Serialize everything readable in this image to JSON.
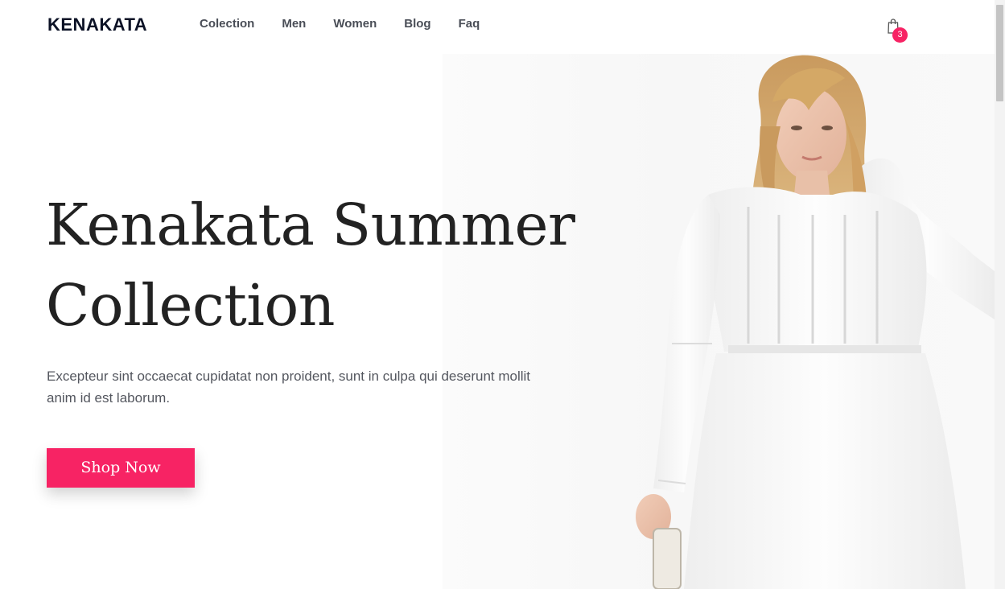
{
  "header": {
    "logo": "KENAKATA",
    "nav": [
      {
        "label": "Colection"
      },
      {
        "label": "Men"
      },
      {
        "label": "Women"
      },
      {
        "label": "Blog"
      },
      {
        "label": "Faq"
      }
    ],
    "cart": {
      "icon": "shopping-bag-icon",
      "count": "3"
    }
  },
  "hero": {
    "title_line1": "Kenakata Summer",
    "title_line2": "Collection",
    "description": "Excepteur sint occaecat cupidatat non proident, sunt in culpa qui deserunt mollit anim id est laborum.",
    "cta_label": "Shop Now",
    "image": "model-in-white-lace-dress"
  },
  "colors": {
    "accent": "#f72364",
    "logo": "#0c1226",
    "title": "#222222",
    "body_text": "#54575f",
    "nav_text": "#4a4e57"
  }
}
